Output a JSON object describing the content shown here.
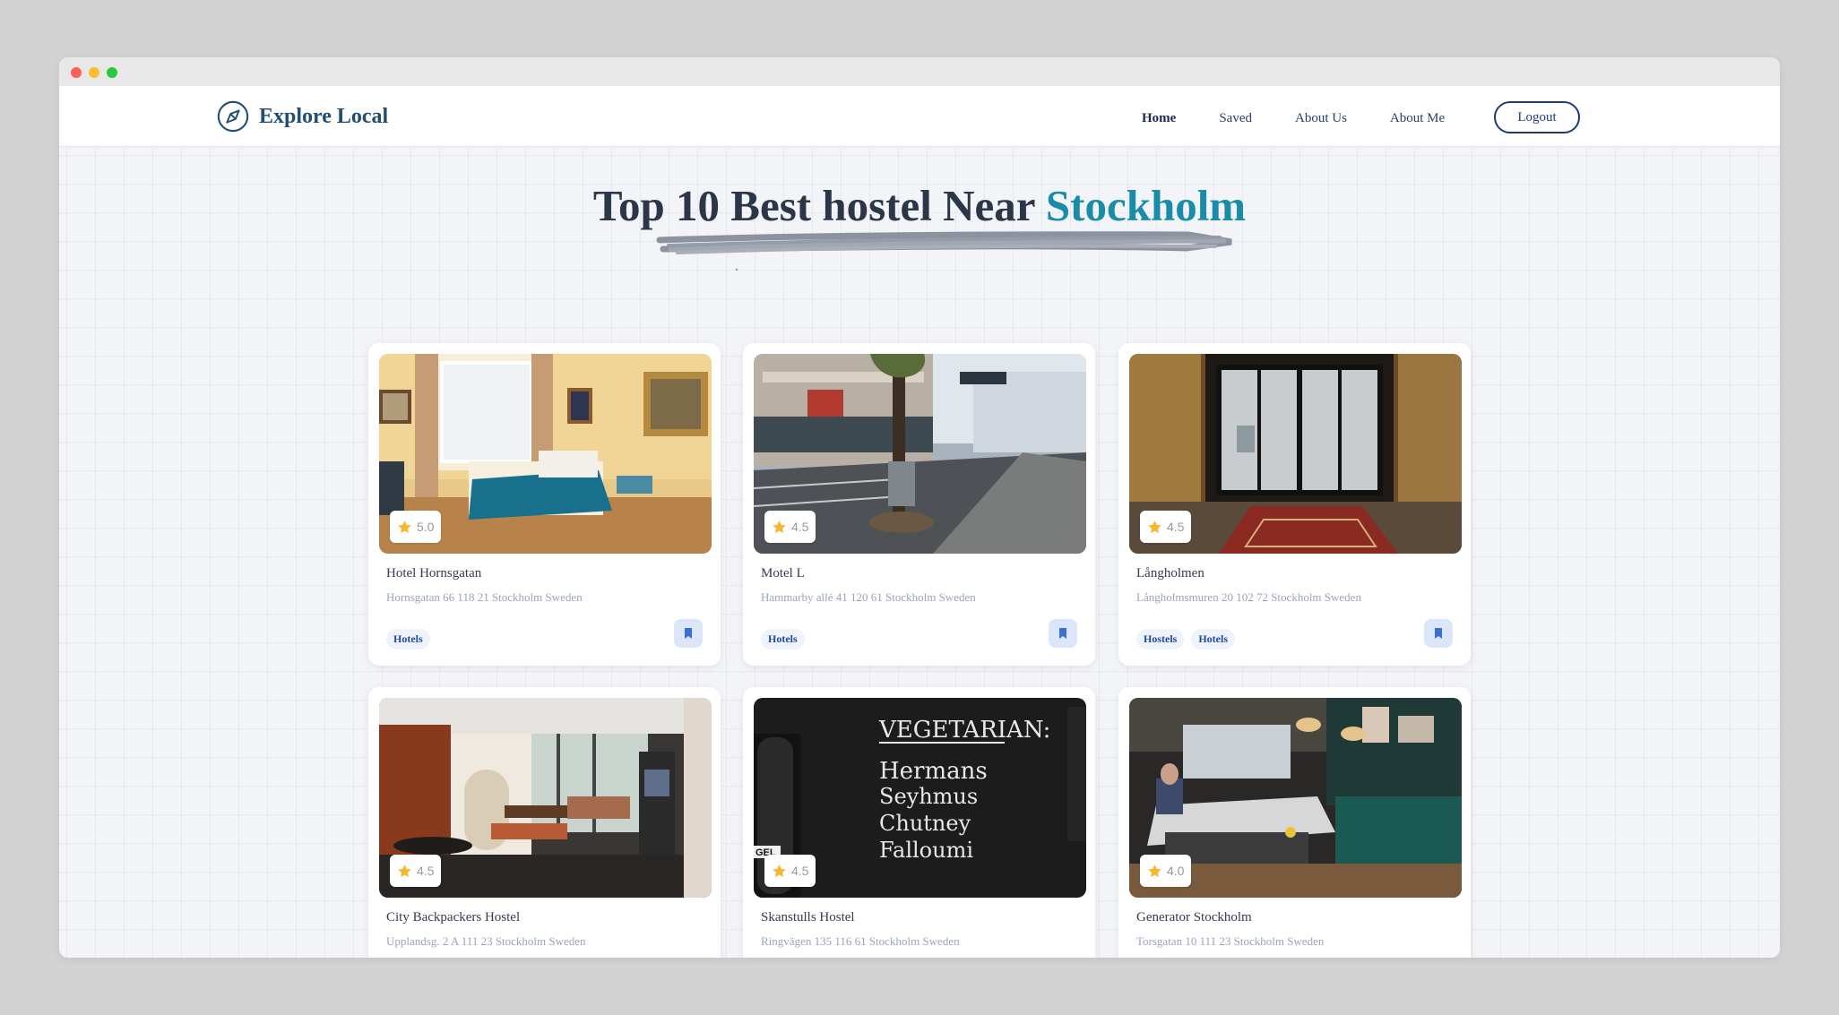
{
  "app": {
    "brand": "Explore Local"
  },
  "nav": {
    "home": "Home",
    "saved": "Saved",
    "about_us": "About Us",
    "about_me": "About Me",
    "logout": "Logout"
  },
  "headline": {
    "prefix": "Top 10 Best hostel Near ",
    "city": "Stockholm"
  },
  "cards": [
    {
      "name": "Hotel Hornsgatan",
      "address": "Hornsgatan 66 118 21 Stockholm Sweden",
      "rating": "5.0",
      "tags": [
        "Hotels"
      ]
    },
    {
      "name": "Motel L",
      "address": "Hammarby allé 41 120 61 Stockholm Sweden",
      "rating": "4.5",
      "tags": [
        "Hotels"
      ]
    },
    {
      "name": "Långholmen",
      "address": "Långholmsmuren 20 102 72 Stockholm Sweden",
      "rating": "4.5",
      "tags": [
        "Hostels",
        "Hotels"
      ]
    },
    {
      "name": "City Backpackers Hostel",
      "address": "Upplandsg. 2 A 111 23 Stockholm Sweden",
      "rating": "4.5",
      "tags": []
    },
    {
      "name": "Skanstulls Hostel",
      "address": "Ringvägen 135 116 61 Stockholm Sweden",
      "rating": "4.5",
      "tags": []
    },
    {
      "name": "Generator Stockholm",
      "address": "Torsgatan 10 111 23 Stockholm Sweden",
      "rating": "4.0",
      "tags": []
    }
  ],
  "photo_text": {
    "chalkboard_heading": "VEGETARIAN:",
    "chalkboard_items": [
      "Hermans",
      "Seyhmus",
      "Chutney",
      "Falloumi"
    ],
    "chalkboard_edge": "GEL"
  },
  "colors": {
    "accent": "#1a8ca8",
    "brand": "#1f4d74",
    "star": "#f5b82e",
    "tag_text": "#1e4aa0"
  },
  "icons": {
    "brand": "compass-icon",
    "rating": "star-icon",
    "save": "bookmark-icon"
  }
}
